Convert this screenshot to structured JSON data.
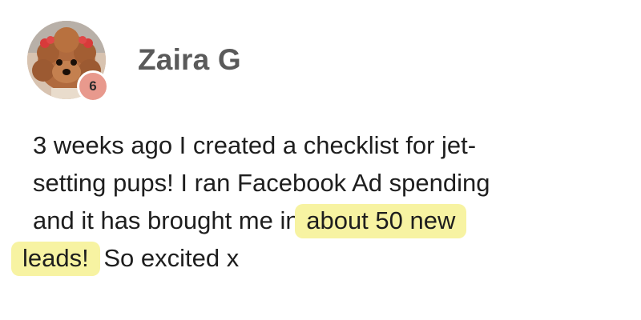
{
  "author": {
    "name": "Zaira G",
    "level": "6"
  },
  "post": {
    "lines": [
      "3 weeks ago I created a checklist for jet-",
      "setting pups!  I ran Facebook Ad spending",
      "and it has brought me in "
    ],
    "highlight_1": "about 50 new",
    "highlight_2": "leads!",
    "tail": " So excited x"
  },
  "colors": {
    "highlight": "#f7f3a2",
    "badge": "#e8998d",
    "name": "#5a5a5a",
    "text": "#1e1e1e"
  },
  "icons": {
    "avatar": "poodle-avatar-photo"
  }
}
